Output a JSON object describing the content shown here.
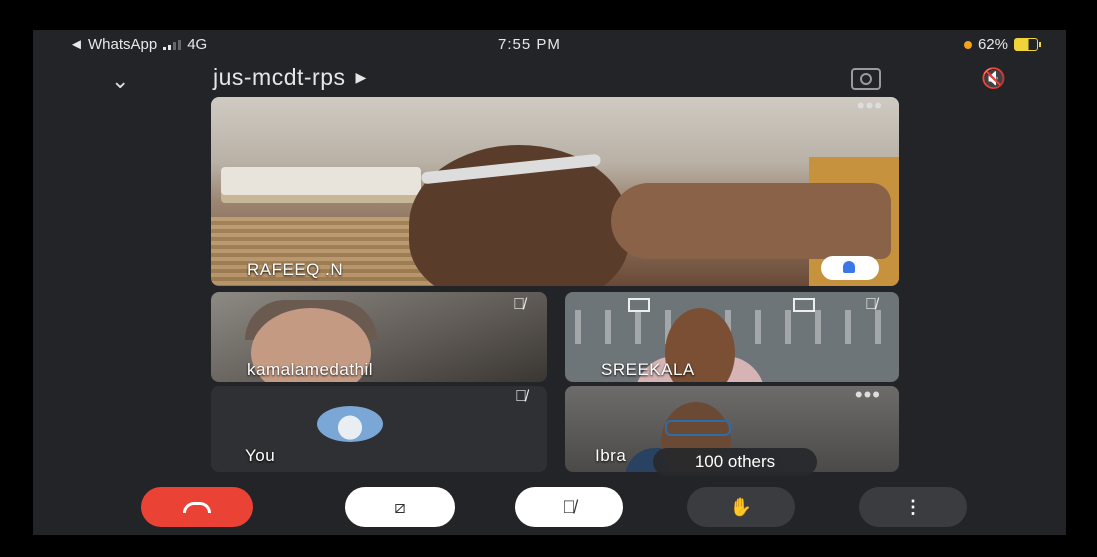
{
  "status_bar": {
    "back_app": "◄ WhatsApp",
    "network": "4G",
    "time": "7:55 PM",
    "battery": "62%"
  },
  "header": {
    "meeting_code": "jus-mcdt-rps",
    "chevron": "chevron-down-icon",
    "camera_switch": "camera-switch-icon",
    "speaker": "speaker-off-icon"
  },
  "participants": {
    "main": {
      "name": "RAFEEQ .N"
    },
    "tile_1": {
      "name": "kamalamedathil"
    },
    "tile_2": {
      "name": "SREEKALA"
    },
    "tile_3": {
      "name": "You"
    },
    "tile_4": {
      "name": "Ibra"
    }
  },
  "others_badge": "100 others",
  "controls": {
    "end_call": "end-call-icon",
    "video": "video-off-icon",
    "mic": "mic-off-icon",
    "raise_hand": "hand-icon",
    "more": "more-options-icon"
  },
  "colors": {
    "background": "#232427",
    "end_call": "#ea4335",
    "pin_accent": "#3b78e7",
    "battery": "#f1d33a"
  }
}
